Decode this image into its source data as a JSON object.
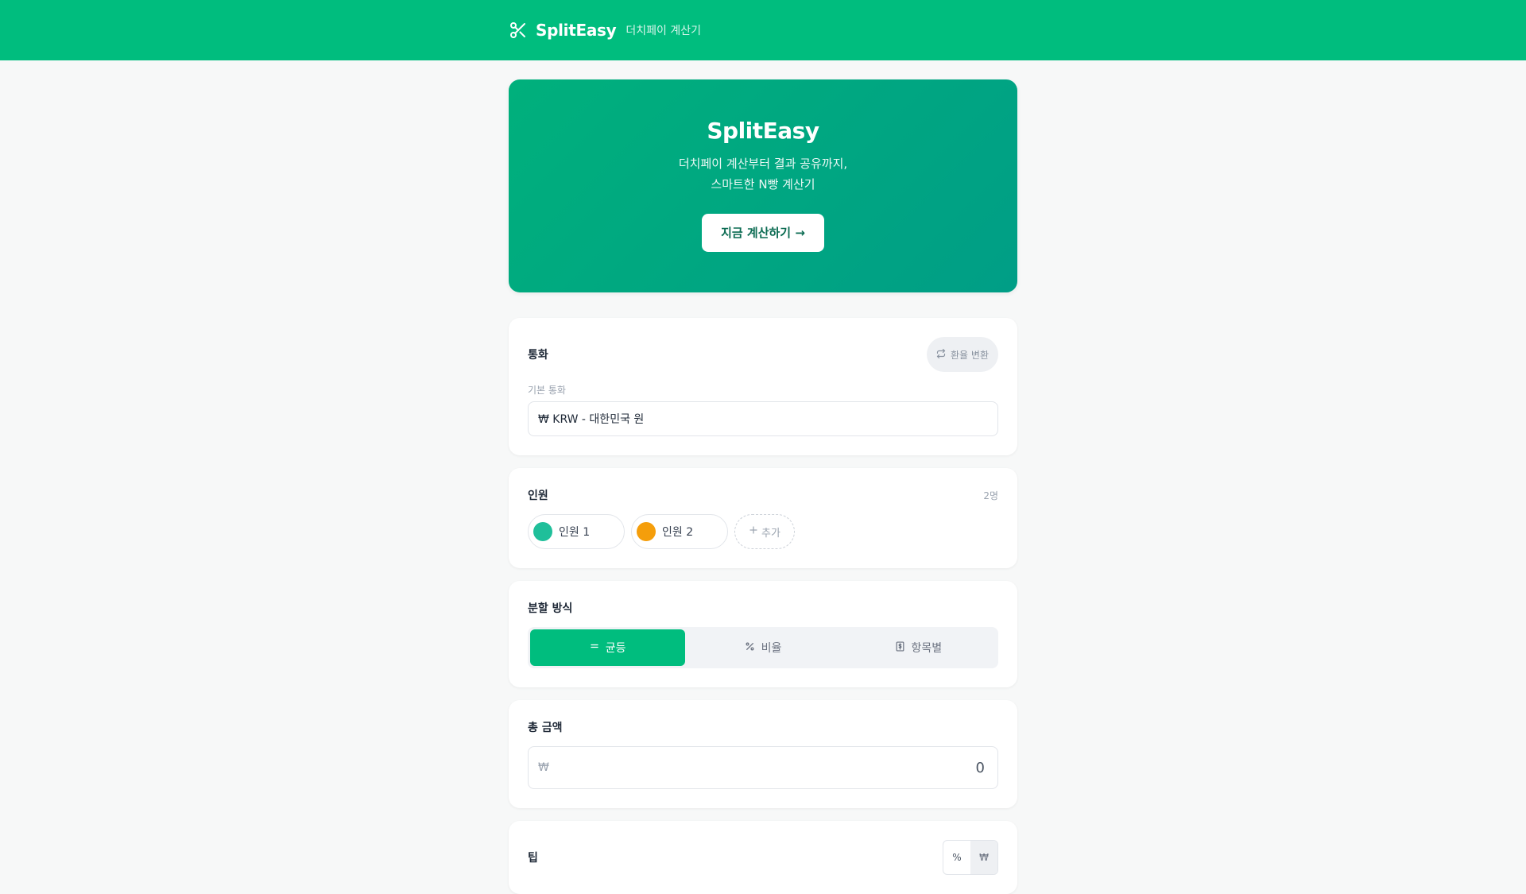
{
  "topbar": {
    "brand": "SplitEasy",
    "subtitle": "더치페이 계산기"
  },
  "hero": {
    "title": "SplitEasy",
    "desc_line1": "더치페이 계산부터 결과 공유까지,",
    "desc_line2": "스마트한 N빵 계산기",
    "cta": "지금 계산하기 →"
  },
  "currency": {
    "title": "통화",
    "convert_label": "환율 변환",
    "base_label": "기본 통화",
    "base_value": "₩ KRW - 대한민국 원"
  },
  "people": {
    "title": "인원",
    "count": "2명",
    "items": [
      {
        "name": "인원 1",
        "color": "#1fbf9a"
      },
      {
        "name": "인원 2",
        "color": "#f59e0b"
      }
    ],
    "add_label": "추가"
  },
  "split": {
    "title": "분할 방식",
    "options": [
      {
        "label": "균등",
        "icon": "equals-icon",
        "active": true
      },
      {
        "label": "비율",
        "icon": "percent-icon",
        "active": false
      },
      {
        "label": "항목별",
        "icon": "receipt-icon",
        "active": false
      }
    ]
  },
  "total": {
    "title": "총 금액",
    "symbol": "₩",
    "value": "0"
  },
  "tip": {
    "title": "팁",
    "opt_percent": "%",
    "opt_won": "₩"
  },
  "colors": {
    "accent": "#00bd7e",
    "hero_start": "#00b07c",
    "hero_end": "#009e86"
  }
}
